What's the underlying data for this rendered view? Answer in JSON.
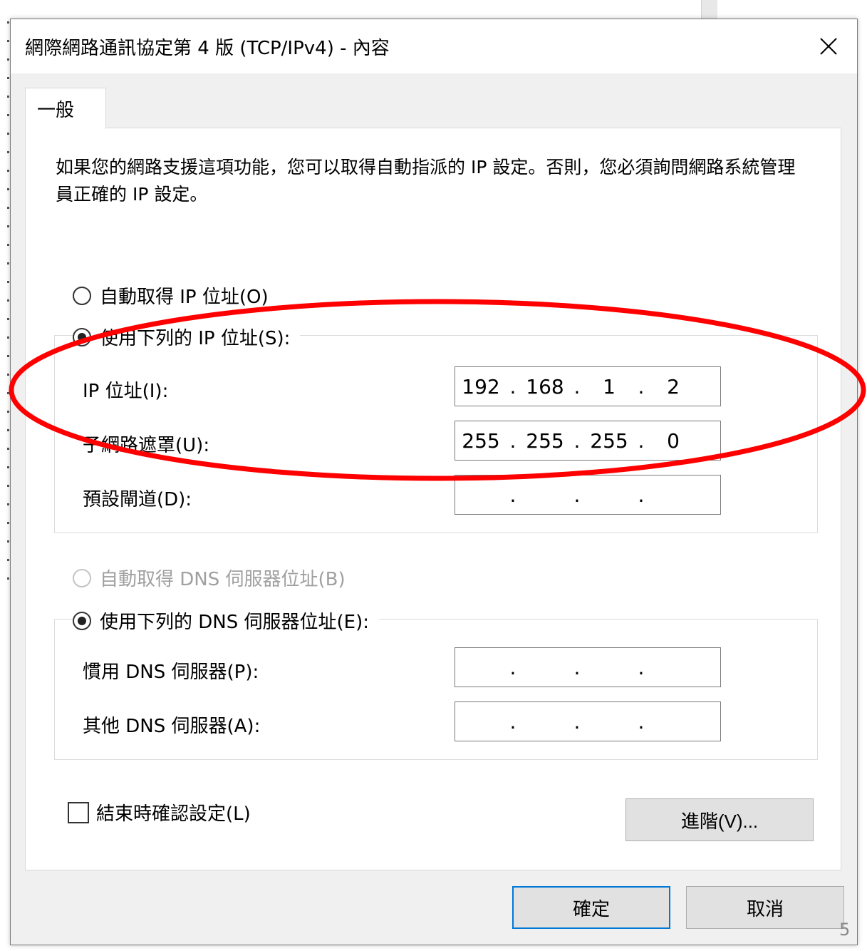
{
  "dialog": {
    "title": "網際網路通訊協定第 4 版 (TCP/IPv4) - 內容",
    "close_icon": "close-icon"
  },
  "tab": {
    "label": "一般"
  },
  "description": "如果您的網路支援這項功能，您可以取得自動指派的 IP 設定。否則，您必須詢問網路系統管理員正確的 IP 設定。",
  "ip_section": {
    "auto_label": "自動取得 IP 位址(O)",
    "manual_label": "使用下列的 IP 位址(S):",
    "selected": "manual",
    "fields": {
      "ip_address": {
        "label": "IP 位址(I):",
        "octets": [
          "192",
          "168",
          "1",
          "2"
        ]
      },
      "subnet_mask": {
        "label": "子網路遮罩(U):",
        "octets": [
          "255",
          "255",
          "255",
          "0"
        ]
      },
      "default_gateway": {
        "label": "預設閘道(D):",
        "octets": [
          "",
          "",
          "",
          ""
        ]
      }
    }
  },
  "dns_section": {
    "auto_label": "自動取得 DNS 伺服器位址(B)",
    "auto_disabled": true,
    "manual_label": "使用下列的 DNS 伺服器位址(E):",
    "selected": "manual",
    "fields": {
      "preferred": {
        "label": "慣用 DNS 伺服器(P):",
        "octets": [
          "",
          "",
          "",
          ""
        ]
      },
      "alternate": {
        "label": "其他 DNS 伺服器(A):",
        "octets": [
          "",
          "",
          "",
          ""
        ]
      }
    }
  },
  "validate_on_exit": {
    "label": "結束時確認設定(L)",
    "checked": false
  },
  "buttons": {
    "advanced": "進階(V)...",
    "ok": "確定",
    "cancel": "取消"
  },
  "page_number": "5",
  "colors": {
    "annotation_ellipse": "#ff0000",
    "default_button_border": "#0078d7"
  }
}
